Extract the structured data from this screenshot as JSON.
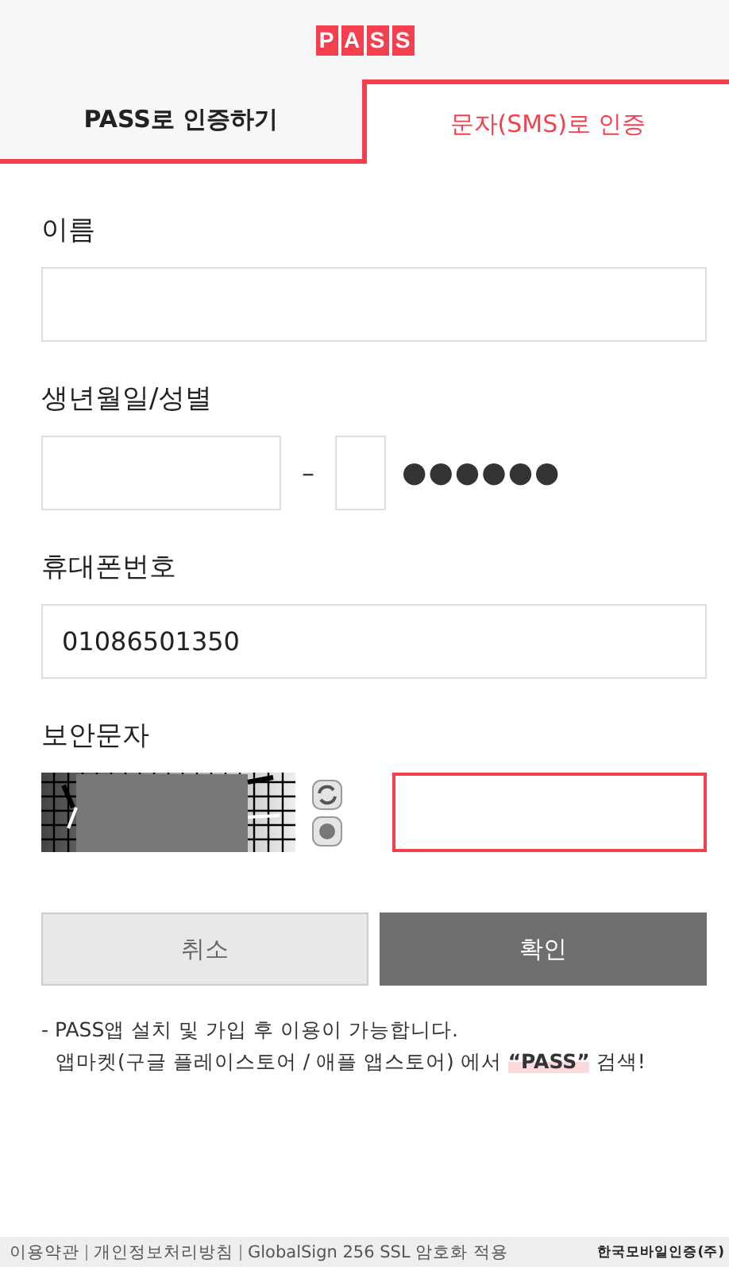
{
  "logo": [
    "P",
    "A",
    "S",
    "S"
  ],
  "tabs": [
    {
      "label": "PASS로 인증하기",
      "selected": false
    },
    {
      "label": "문자(SMS)로 인증",
      "selected": true
    }
  ],
  "name": {
    "label": "이름"
  },
  "birth": {
    "label": "생년월일/성별",
    "separator": "–",
    "masked": "●●●●●●"
  },
  "phone": {
    "label": "휴대폰번호",
    "value": "01086501350"
  },
  "captcha": {
    "label": "보안문자",
    "focused": true
  },
  "buttons": [
    {
      "label": "취소",
      "kind": "secondary"
    },
    {
      "label": "확인",
      "kind": "primary"
    }
  ],
  "notes": [
    "- PASS앱 설치 및 가입 후 이용이 가능합니다.",
    "앱마켓(구글 플레이스토어 / 애플 앱스토어) 에서 **“PASS”** 검색!"
  ],
  "footer": {
    "links": [
      "이용약관",
      "개인정보처리방침",
      "GlobalSign 256 SSL 암호화 적용"
    ],
    "company": "한국모바일인증(주)"
  }
}
